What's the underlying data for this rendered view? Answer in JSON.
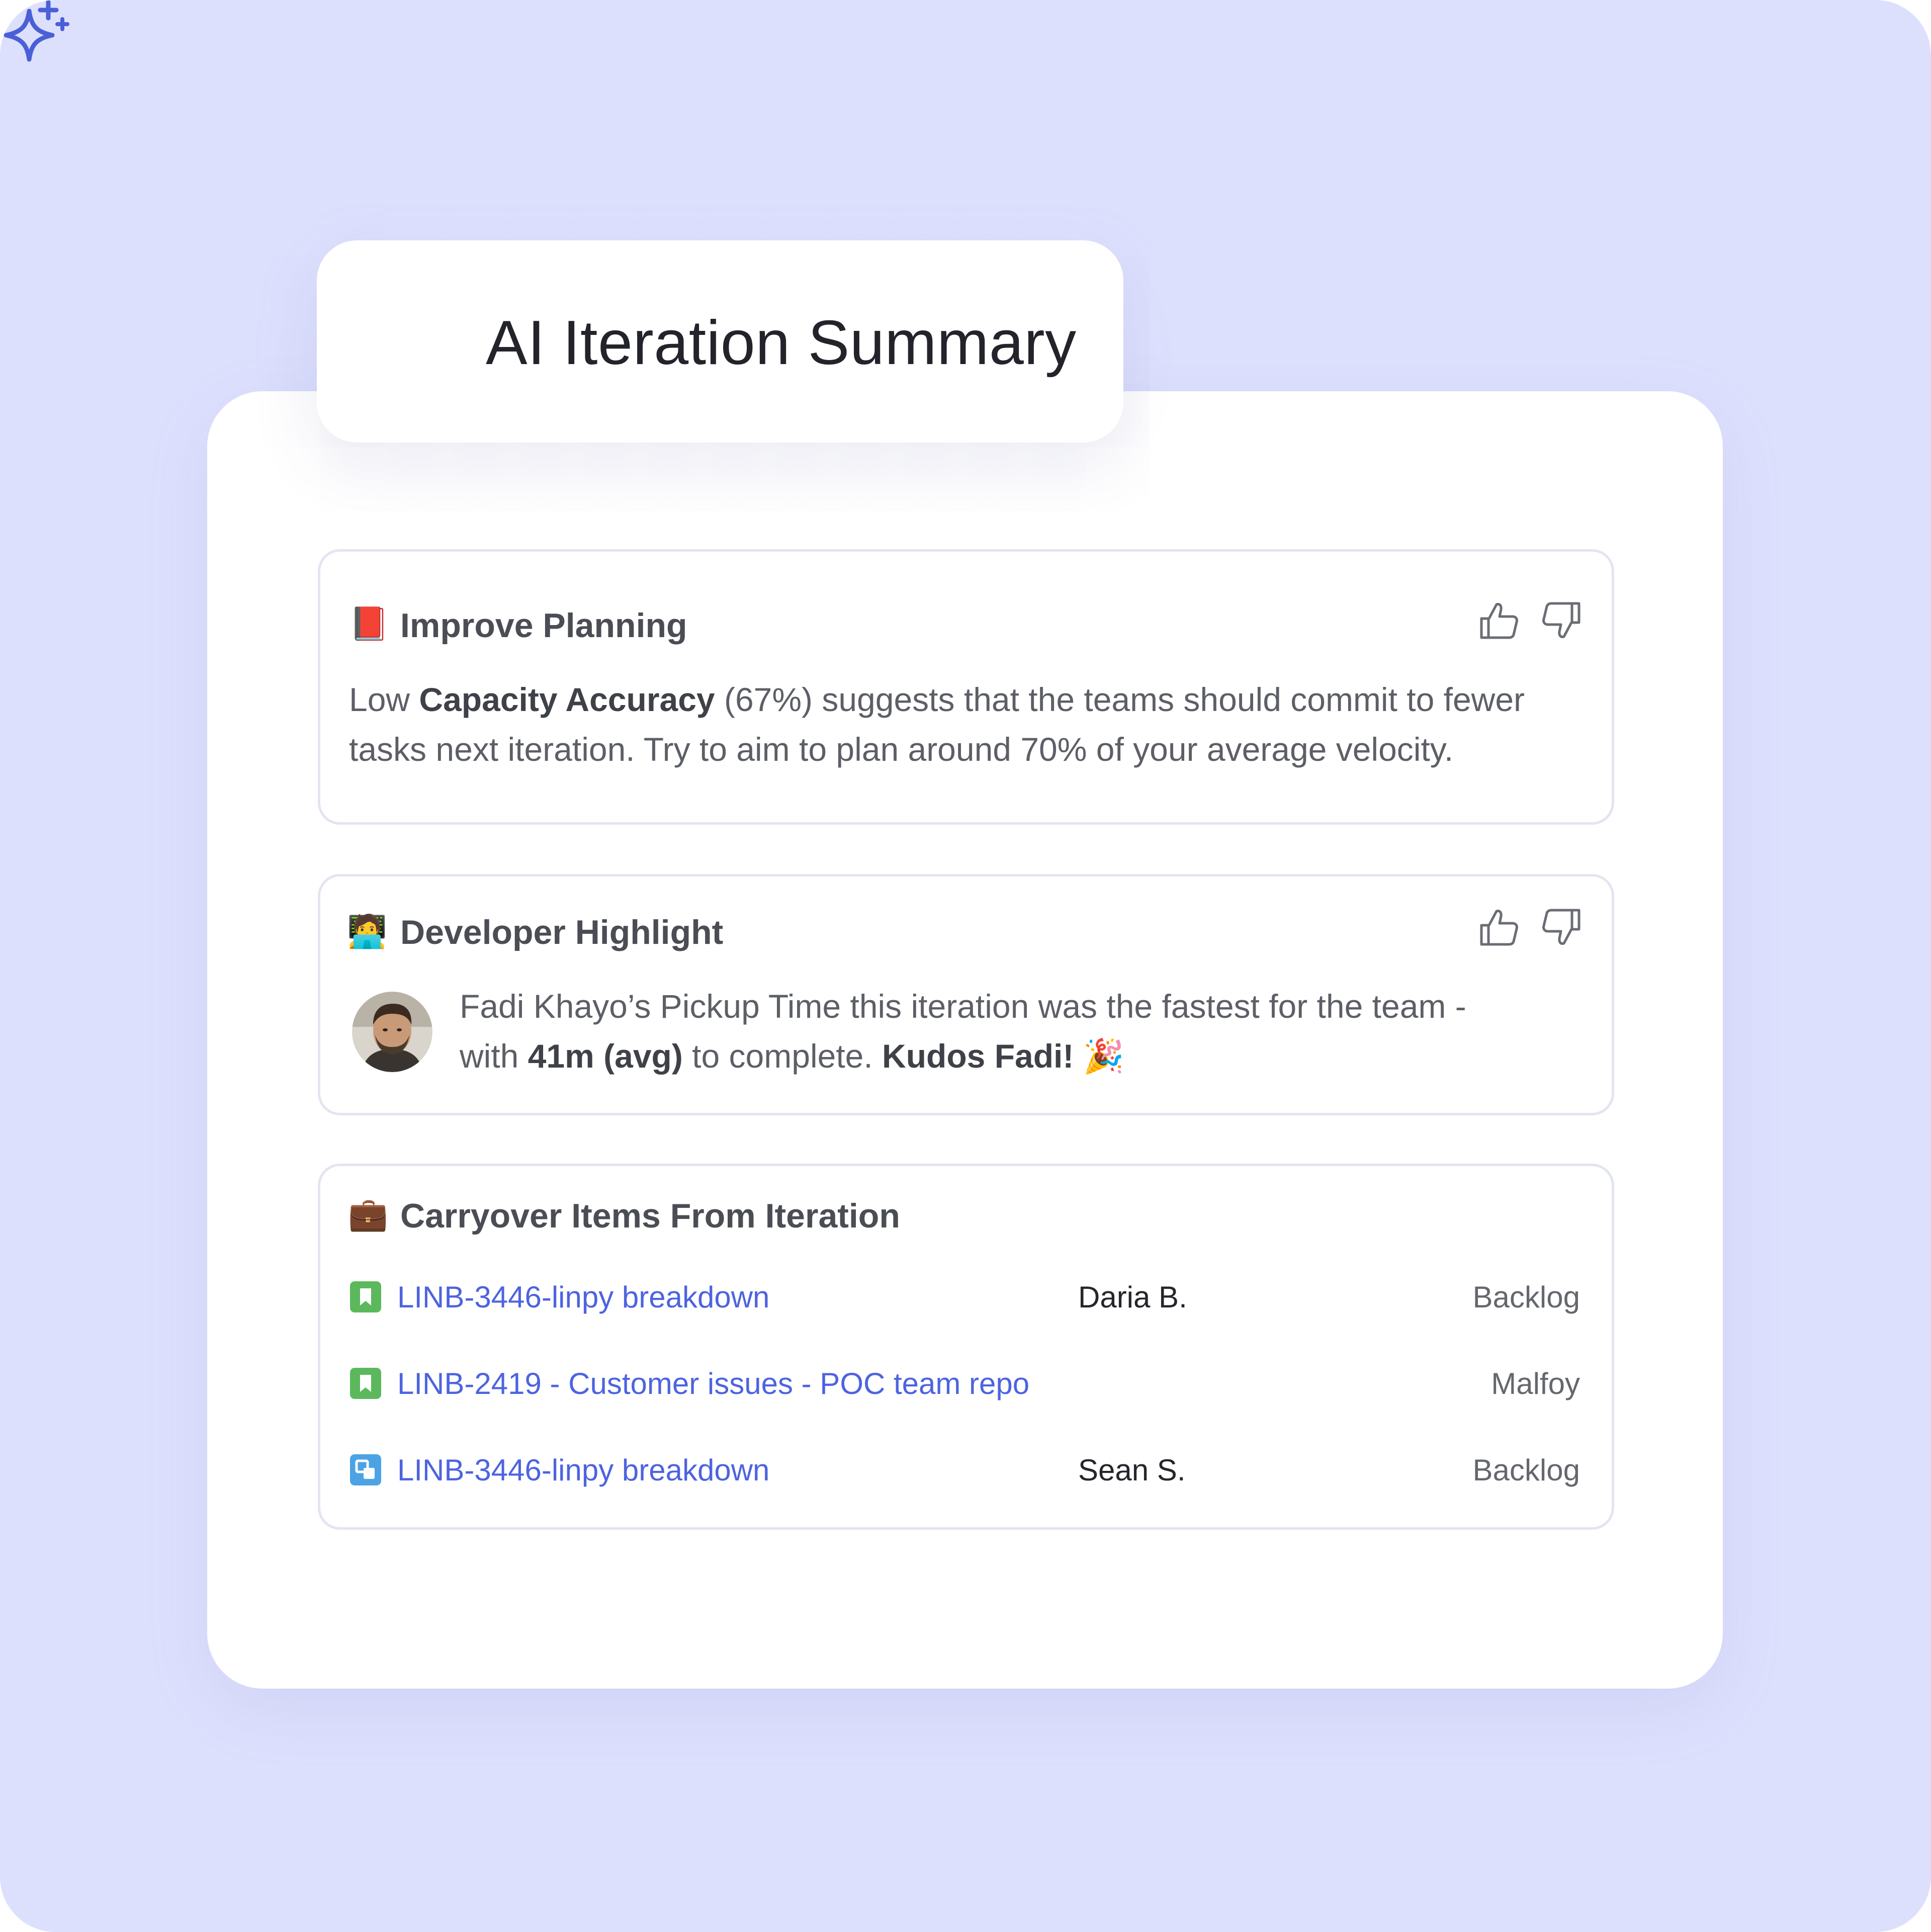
{
  "header": {
    "title": "AI Iteration Summary"
  },
  "cards": {
    "planning": {
      "emoji": "📕",
      "title": "Improve Planning",
      "line1_a": "Low ",
      "line1_b": "Capacity Accuracy",
      "line1_c": " (67%) suggests that the teams should commit to fewer",
      "line2": "tasks next iteration. Try to aim to plan around 70% of your average velocity."
    },
    "developer": {
      "emoji": "🧑‍💻",
      "title": "Developer Highlight",
      "line1": "Fadi Khayo’s Pickup Time this iteration was the fastest for the team -",
      "line2_a": "with ",
      "line2_b": "41m (avg)",
      "line2_c": " to complete. ",
      "line2_d": "Kudos Fadi!",
      "line2_e": " 🎉"
    },
    "carryover": {
      "emoji": "💼",
      "title": "Carryover Items From Iteration",
      "rows": [
        {
          "link": "LINB-3446-linpy breakdown",
          "assignee": "Daria B.",
          "status": "Backlog",
          "icon": "story-icon"
        },
        {
          "link": "LINB-2419 - Customer issues - POC team repo",
          "assignee": "",
          "status": "Malfoy",
          "icon": "story-icon"
        },
        {
          "link": "LINB-3446-linpy breakdown",
          "assignee": "Sean S.",
          "status": "Backlog",
          "icon": "subtask-icon"
        }
      ]
    }
  },
  "colors": {
    "background": "#dde0fd",
    "accent": "#4d63e0",
    "story_icon": "#5cb85c",
    "subtask_icon": "#4ba3e3",
    "sparkle": "#4b5fd6"
  }
}
